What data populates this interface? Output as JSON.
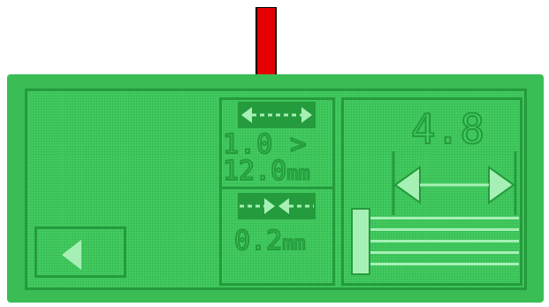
{
  "nav": {
    "back_icon": "left-triangle-icon"
  },
  "pulse_width": {
    "icon": "double-arrow-with-dashes-icon",
    "range_line1": "1.0 >",
    "range_line2_value": "12.0",
    "range_line2_unit": "mm"
  },
  "gap": {
    "icon": "converging-arrows-icon",
    "value": "0.2",
    "unit": "mm"
  },
  "display": {
    "value": "4.8",
    "icon": "double-headed-dimension-arrow-icon"
  },
  "pointer": {
    "icon": "red-down-arrow-icon",
    "color": "#e60000"
  },
  "colors": {
    "screen": "#41cc5f",
    "ink": "#249b3c",
    "bezel": "#3bbd55",
    "highlight": "#a6f0b6"
  }
}
